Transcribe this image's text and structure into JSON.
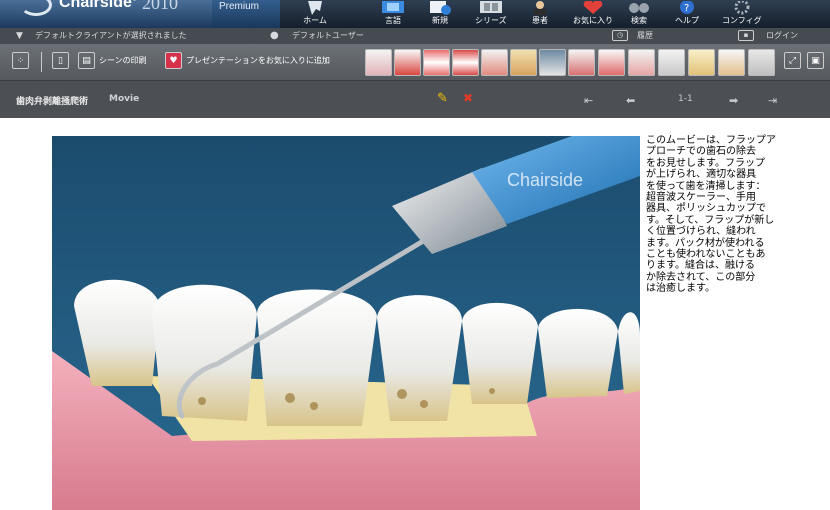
{
  "app": {
    "brand": "Chairside",
    "trademark": "®",
    "year": "2010",
    "edition": "Premium"
  },
  "toolbar": {
    "items": [
      {
        "label": "ホーム",
        "icon": "tooth-home-icon"
      },
      {
        "label": "言語",
        "icon": "language-book-icon"
      },
      {
        "label": "新規",
        "icon": "new-document-icon"
      },
      {
        "label": "シリーズ",
        "icon": "film-strip-icon"
      },
      {
        "label": "患者",
        "icon": "patient-icon"
      },
      {
        "label": "お気に入り",
        "icon": "heart-favorite-icon"
      },
      {
        "label": "検索",
        "icon": "binoculars-search-icon"
      },
      {
        "label": "ヘルプ",
        "icon": "help-question-icon"
      },
      {
        "label": "コンフィグ",
        "icon": "gear-config-icon"
      }
    ]
  },
  "status": {
    "client": "デフォルトクライアントが選択されました",
    "user": "デフォルトユーザー",
    "history": "履歴",
    "login": "ログイン"
  },
  "toolbar2": {
    "print_scene": "シーンの印刷",
    "add_presentation": "プレゼンテーションをお気に入りに追加",
    "thumbnails_count": 14
  },
  "title": {
    "text": "歯肉弁剥離掻爬術",
    "type": "Movie",
    "page": "1-1"
  },
  "video": {
    "watermark": "Chairside"
  },
  "description": "このムービーは、フラップア\nプローチでの歯石の除去\nをお見せします。フラップ\nが上げられ、適切な器具\nを使って歯を清掃します：\n超音波スケーラー、手用\n器具、ポリッシュカップで\nす。そして、フラップが新し\nく位置づけられ、縫われ\nます。パック材が使われる\nことも使われないこともあ\nります。縫合は、融ける\nか除去されて、この部分\nは治癒します。",
  "colors": {
    "topbar": "#1b2533",
    "statusbar": "#454b51",
    "toolbar2": "#62676c",
    "titlebar": "#4c4f54",
    "accent_red": "#e03a2a",
    "accent_yellow": "#f0c000",
    "gum": "#e58fa2",
    "bone": "#f2e2a6",
    "video_bg": "#1d5478"
  }
}
